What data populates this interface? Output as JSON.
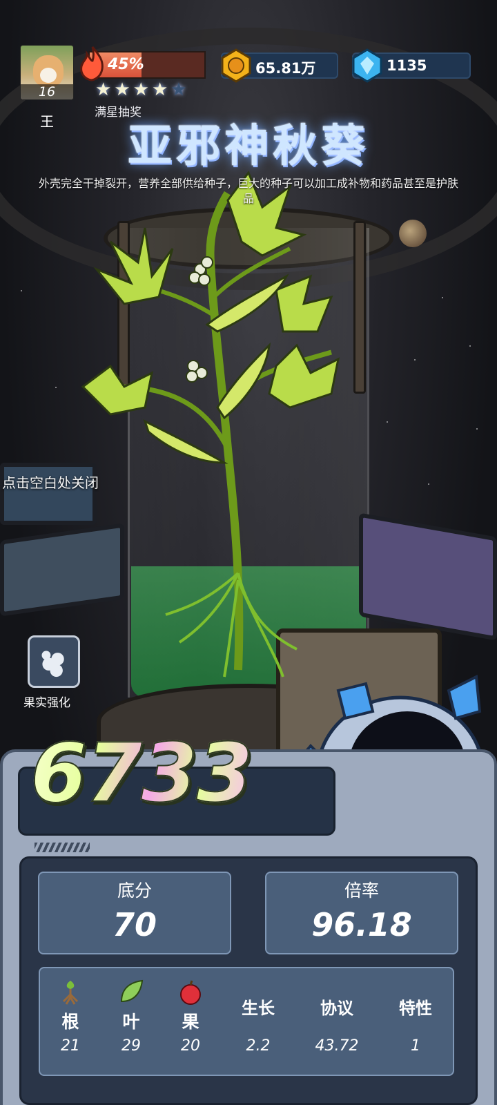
{
  "player": {
    "level": "16",
    "name": "王"
  },
  "hud": {
    "progress_text": "45%",
    "progress_fraction": 0.45,
    "stars_filled": 4,
    "stars_total": 5,
    "star_lottery_label": "满星抽奖",
    "gold_value": "65.81万",
    "gem_value": "1135"
  },
  "plant": {
    "name": "亚邪神秋葵",
    "description": "外壳完全干掉裂开，营养全部供给种子，巨大的种子可以加工成补物和药品甚至是护肤品"
  },
  "close_hint": "点击空白处关闭",
  "fruit_upgrade": {
    "label": "果实强化",
    "icon": "berries-icon"
  },
  "score": {
    "total": "6733",
    "base_label": "底分",
    "base_value": "70",
    "rate_label": "倍率",
    "rate_value": "96.18"
  },
  "stats": [
    {
      "name": "根",
      "value": "21",
      "icon": "root-icon"
    },
    {
      "name": "叶",
      "value": "29",
      "icon": "leaf-icon"
    },
    {
      "name": "果",
      "value": "20",
      "icon": "apple-icon"
    },
    {
      "name": "生长",
      "value": "2.2"
    },
    {
      "name": "协议",
      "value": "43.72"
    },
    {
      "name": "特性",
      "value": "1"
    }
  ],
  "colors": {
    "accent_progress": "#d8523a",
    "panel": "#4a5f7a",
    "liquid": "#3fb860"
  }
}
